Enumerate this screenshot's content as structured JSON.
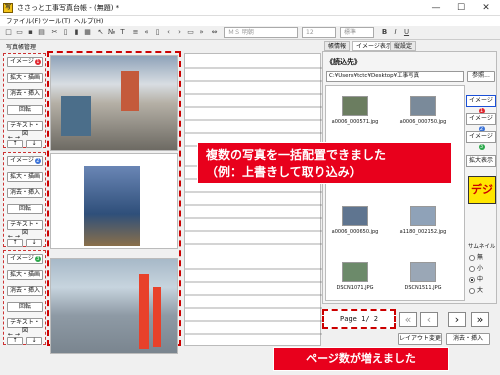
{
  "window": {
    "title": "ささっと工事写真台帳 - (無題) *",
    "min": "—",
    "max": "☐",
    "close": "✕"
  },
  "menu": [
    "ファイル(F)",
    "ツール(T)",
    "ヘルプ(H)"
  ],
  "toolbar": {
    "font": "ＭＳ 明朝",
    "size": "12",
    "style": "標準"
  },
  "left": {
    "header": "写真帳管理",
    "groups": [
      {
        "image_label": "イメージ",
        "badge": "1",
        "badge_color": "#e0262f",
        "enlarge": "拡大・描画",
        "erase": "消去・挿入",
        "rotate": "回転",
        "text": "テキスト・図"
      },
      {
        "image_label": "イメージ",
        "badge": "2",
        "badge_color": "#3a72d8",
        "enlarge": "拡大・描画",
        "erase": "消去・挿入",
        "rotate": "回転",
        "text": "テキスト・図"
      },
      {
        "image_label": "イメージ",
        "badge": "3",
        "badge_color": "#2aa84a",
        "enlarge": "拡大・描画",
        "erase": "消去・挿入",
        "rotate": "回転",
        "text": "テキスト・図"
      }
    ]
  },
  "right": {
    "tabs": [
      "帳情報",
      "イメージ表示",
      "縦設定"
    ],
    "folder_label": "《読込先》",
    "folder_path": "C:¥Users¥tctc¥Desktop¥工事写真",
    "browse": "参照...",
    "thumbs": [
      "a0006_000571.jpg",
      "a0006_000750.jpg",
      "a0006_000650.jpg",
      "a1180_002152.jpg",
      "DSCN1071.JPG",
      "DSCN1511.JPG"
    ],
    "side_buttons": [
      "イメージ",
      "イメージ",
      "イメージ"
    ],
    "enlarge_view": "拡大表示",
    "digi_logo": "デジ",
    "thumbnail_size_label": "サムネイル",
    "sizes": [
      "無",
      "小",
      "中",
      "大"
    ],
    "selected_size": "中",
    "page": "Page 1/ 2",
    "layout_change": "レイアウト変更",
    "erase_insert": "消去・挿入"
  },
  "callouts": {
    "main_line1": "複数の写真を一括配置できました",
    "main_line2": "（例：上書きして取り込み）",
    "bottom": "ページ数が増えました"
  },
  "colors": {
    "accent_red": "#e8001c",
    "badge_red": "#e0262f",
    "badge_blue": "#3a72d8",
    "badge_green": "#2aa84a"
  }
}
